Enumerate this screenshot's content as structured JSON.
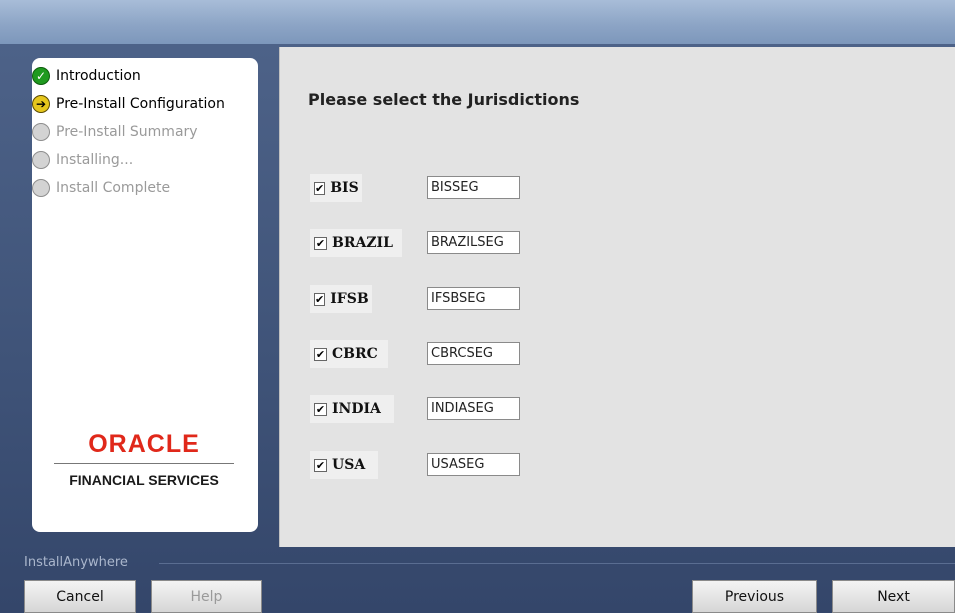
{
  "steps": [
    {
      "label": "Introduction",
      "state": "done"
    },
    {
      "label": "Pre-Install Configuration",
      "state": "current"
    },
    {
      "label": "Pre-Install Summary",
      "state": "pending"
    },
    {
      "label": "Installing...",
      "state": "pending"
    },
    {
      "label": "Install Complete",
      "state": "pending"
    }
  ],
  "logo": {
    "wordmark": "ORACLE",
    "subtitle": "FINANCIAL SERVICES",
    "color": "#e0281a"
  },
  "main": {
    "heading": "Please select the Jurisdictions",
    "jurisdictions": [
      {
        "label": "BIS",
        "checked": true,
        "value": "BISSEG"
      },
      {
        "label": "BRAZIL",
        "checked": true,
        "value": "BRAZILSEG"
      },
      {
        "label": "IFSB",
        "checked": true,
        "value": "IFSBSEG"
      },
      {
        "label": "CBRC",
        "checked": true,
        "value": "CBRCSEG"
      },
      {
        "label": "INDIA",
        "checked": true,
        "value": "INDIASEG"
      },
      {
        "label": "USA",
        "checked": true,
        "value": "USASEG"
      }
    ]
  },
  "footer": {
    "brand": "InstallAnywhere",
    "cancel": "Cancel",
    "help": "Help",
    "previous": "Previous",
    "next": "Next"
  }
}
